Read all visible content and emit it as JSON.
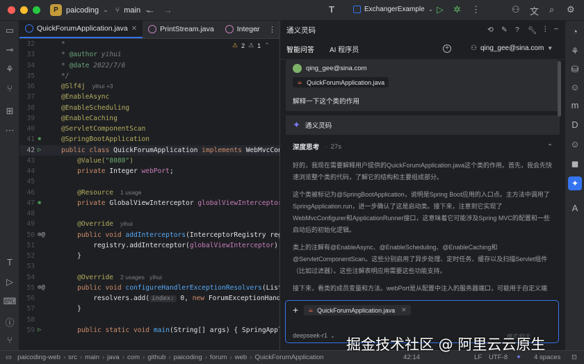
{
  "titlebar": {
    "project_badge": "P",
    "project_name": "paicoding",
    "branch": "main",
    "run_config": "ExchangerExample"
  },
  "editor": {
    "tabs": [
      "QuickForumApplication.java",
      "PrintStream.java",
      "Integer"
    ],
    "inspection": {
      "warnings": "2",
      "weak": "1"
    },
    "lines": [
      {
        "n": "32",
        "parts": [
          {
            "c": "c",
            "t": "*"
          }
        ]
      },
      {
        "n": "33",
        "parts": [
          {
            "c": "c",
            "t": "* "
          },
          {
            "c": "cd",
            "t": "@author"
          },
          {
            "c": "c",
            "t": " yihui"
          }
        ]
      },
      {
        "n": "34",
        "parts": [
          {
            "c": "c",
            "t": "* "
          },
          {
            "c": "cd",
            "t": "@date"
          },
          {
            "c": "c",
            "t": " 2022/7/6"
          }
        ]
      },
      {
        "n": "35",
        "parts": [
          {
            "c": "c",
            "t": "*/"
          }
        ]
      },
      {
        "n": "36",
        "parts": [
          {
            "c": "a",
            "t": "@Slf4j"
          }
        ],
        "hint": "yihui +3"
      },
      {
        "n": "37",
        "parts": [
          {
            "c": "a",
            "t": "@EnableAsync"
          }
        ]
      },
      {
        "n": "38",
        "parts": [
          {
            "c": "a",
            "t": "@EnableScheduling"
          }
        ]
      },
      {
        "n": "39",
        "parts": [
          {
            "c": "a",
            "t": "@EnableCaching"
          }
        ]
      },
      {
        "n": "40",
        "parts": [
          {
            "c": "a",
            "t": "@ServletComponentScan"
          }
        ]
      },
      {
        "n": "41",
        "parts": [
          {
            "c": "a",
            "t": "@SpringBootApplication"
          }
        ]
      },
      {
        "n": "42",
        "parts": [
          {
            "c": "k",
            "t": "public class "
          },
          {
            "c": "",
            "t": "QuickForumApplication "
          },
          {
            "c": "k",
            "t": "implements "
          },
          {
            "c": "",
            "t": "WebMvcConfig"
          }
        ]
      },
      {
        "n": "43",
        "parts": [
          {
            "c": "a",
            "t": "    @Value("
          },
          {
            "c": "s",
            "t": "\"8080\""
          },
          {
            "c": "a",
            "t": ")"
          }
        ]
      },
      {
        "n": "44",
        "parts": [
          {
            "c": "k",
            "t": "    private "
          },
          {
            "c": "",
            "t": "Integer "
          },
          {
            "c": "v",
            "t": "webPort"
          },
          {
            "c": "",
            "t": ";"
          }
        ]
      },
      {
        "n": "45",
        "parts": []
      },
      {
        "n": "46",
        "parts": [
          {
            "c": "a",
            "t": "    @Resource"
          }
        ],
        "hint": "1 usage"
      },
      {
        "n": "47",
        "parts": [
          {
            "c": "k",
            "t": "    private "
          },
          {
            "c": "",
            "t": "GlobalViewInterceptor "
          },
          {
            "c": "v",
            "t": "globalViewInterceptor"
          },
          {
            "c": "",
            "t": ";"
          }
        ]
      },
      {
        "n": "48",
        "parts": []
      },
      {
        "n": "49",
        "parts": [
          {
            "c": "a",
            "t": "    @Override"
          }
        ],
        "hint": "yihui"
      },
      {
        "n": "50",
        "parts": [
          {
            "c": "k",
            "t": "    public void "
          },
          {
            "c": "f",
            "t": "addInterceptors"
          },
          {
            "c": "",
            "t": "(InterceptorRegistry regist"
          }
        ]
      },
      {
        "n": "51",
        "parts": [
          {
            "c": "",
            "t": "        registry.addInterceptor("
          },
          {
            "c": "v",
            "t": "globalViewInterceptor"
          },
          {
            "c": "",
            "t": ").add"
          }
        ]
      },
      {
        "n": "52",
        "parts": [
          {
            "c": "",
            "t": "    }"
          }
        ]
      },
      {
        "n": "53",
        "parts": []
      },
      {
        "n": "54",
        "parts": [
          {
            "c": "a",
            "t": "    @Override"
          }
        ],
        "hint": "2 usages   yihui"
      },
      {
        "n": "55",
        "parts": [
          {
            "c": "k",
            "t": "    public void "
          },
          {
            "c": "f",
            "t": "configureHandlerExceptionResolvers"
          },
          {
            "c": "",
            "t": "(List<Ha"
          }
        ]
      },
      {
        "n": "56",
        "parts": [
          {
            "c": "",
            "t": "        resolvers.add("
          },
          {
            "c": "ih",
            "t": "index:"
          },
          {
            "c": "",
            "t": " 0, "
          },
          {
            "c": "k",
            "t": "new "
          },
          {
            "c": "",
            "t": "ForumExceptionHandler()"
          }
        ]
      },
      {
        "n": "57",
        "parts": [
          {
            "c": "",
            "t": "    }"
          }
        ]
      },
      {
        "n": "58",
        "parts": []
      },
      {
        "n": "59",
        "parts": [
          {
            "c": "k",
            "t": "    public static void "
          },
          {
            "c": "f",
            "t": "main"
          },
          {
            "c": "",
            "t": "(String[] args) { SpringApplica"
          }
        ]
      }
    ]
  },
  "ai_panel": {
    "title": "通义灵码",
    "tabs": [
      "智能问答",
      "AI 程序员"
    ],
    "user": "qing_gee@sina.com",
    "conversation": {
      "user_name": "qing_gee@sina.com",
      "attachment": "QuickForumApplication.java",
      "question": "解释一下这个类的作用",
      "bot_name": "通义灵码",
      "thinking_label": "深度思考",
      "thinking_time": "27s",
      "paragraphs": [
        "好的，我现在需要解释用户提供的QuickForumApplication.java这个类的作用。首先，我会先快速浏览整个类的代码，了解它的结构和主要组成部分。",
        "这个类被标记为@SpringBootApplication，说明是Spring Boot应用的入口点。主方法中调用了SpringApplication.run，进一步确认了这是启动类。接下来，注意到它实现了WebMvcConfigurer和ApplicationRunner接口，这意味着它可能涉及Spring MVC的配置和一些启动后的初始化逻辑。",
        "类上的注解有@EnableAsync、@EnableScheduling、@EnableCaching和@ServletComponentScan。这些分别启用了异步处理、定时任务、缓存以及扫描Servlet组件（比如过滤器）。这些注解表明应用需要这些功能支持。",
        "接下来，看类的成员变量和方法。webPort是从配置中注入的服务器端口，可能用于自定义端"
      ]
    },
    "input": {
      "attachment": "QuickForumApplication.java",
      "model": "deepseek-r1",
      "placeholder": "模式/聊天"
    }
  },
  "statusbar": {
    "breadcrumbs": [
      "paicoding-web",
      "src",
      "main",
      "java",
      "com",
      "github",
      "paicoding",
      "forum",
      "web",
      "QuickForumApplication"
    ],
    "position": "42:14",
    "line_sep": "LF",
    "encoding": "UTF-8",
    "indent": "4 spaces"
  },
  "watermark": "掘金技术社区 @ 阿里云云原生",
  "colors": {
    "accent": "#3574f0",
    "background": "#1e1f22",
    "panel": "#2b2d30"
  }
}
